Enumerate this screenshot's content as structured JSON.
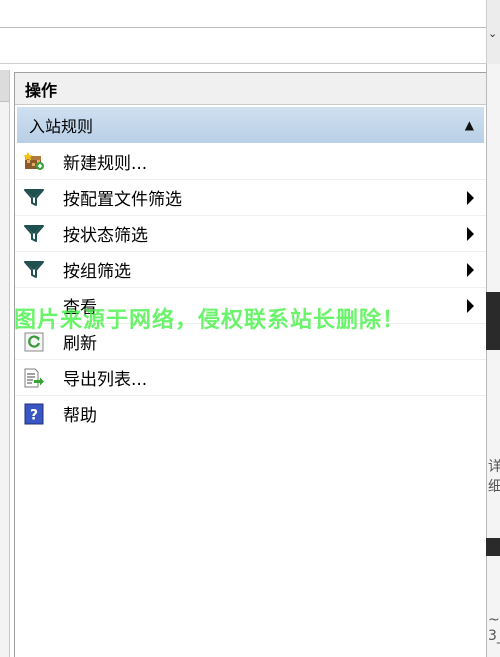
{
  "top": {
    "chevron": "⌄"
  },
  "panel": {
    "title": "操作",
    "section": {
      "label": "入站规则",
      "collapse_glyph": "▲"
    },
    "items": [
      {
        "label": "新建规则...",
        "icon": "new-rule-icon",
        "submenu": false
      },
      {
        "label": "按配置文件筛选",
        "icon": "filter-icon",
        "submenu": true
      },
      {
        "label": "按状态筛选",
        "icon": "filter-icon",
        "submenu": true
      },
      {
        "label": "按组筛选",
        "icon": "filter-icon",
        "submenu": true
      },
      {
        "label": "查看",
        "icon": "",
        "submenu": true
      },
      {
        "label": "刷新",
        "icon": "refresh-icon",
        "submenu": false
      },
      {
        "label": "导出列表...",
        "icon": "export-list-icon",
        "submenu": false
      },
      {
        "label": "帮助",
        "icon": "help-icon",
        "submenu": false
      }
    ]
  },
  "right_edge": {
    "fragment_1": "详细",
    "fragment_2": "~",
    "fragment_3": "3_"
  },
  "watermark": "图片来源于网络，侵权联系站长删除！",
  "colors": {
    "section_bg": "#c5d9ee",
    "watermark": "#3cf03c",
    "filter_icon": "#1f4f4f"
  }
}
